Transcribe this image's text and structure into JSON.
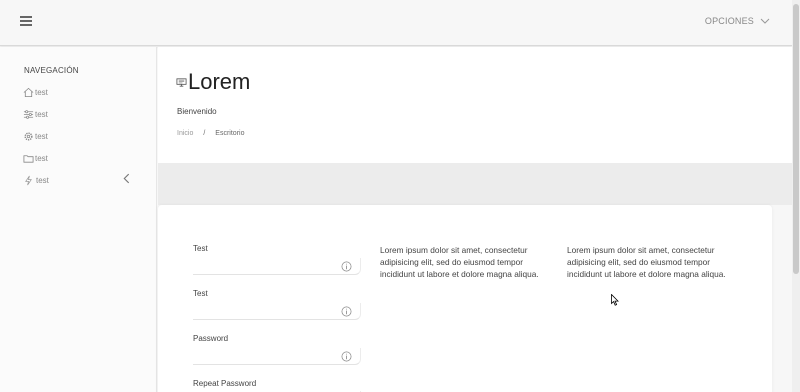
{
  "topbar": {
    "options_label": "OPCIONES"
  },
  "sidebar": {
    "title": "NAVEGACIÓN",
    "items": [
      {
        "label": "test",
        "icon": "home-icon"
      },
      {
        "label": "test",
        "icon": "sliders-icon"
      },
      {
        "label": "test",
        "icon": "gear-icon"
      },
      {
        "label": "test",
        "icon": "folder-icon"
      },
      {
        "label": "test",
        "icon": "lightning-icon"
      }
    ]
  },
  "header": {
    "icon": "computer-icon",
    "title": "Lorem",
    "welcome": "Bienvenido",
    "breadcrumb": {
      "home": "Inicio",
      "separator": "/",
      "current": "Escritorio"
    }
  },
  "form": {
    "fields": [
      {
        "label": "Test",
        "value": ""
      },
      {
        "label": "Test",
        "value": ""
      },
      {
        "label": "Password",
        "value": ""
      },
      {
        "label": "Repeat Password",
        "value": ""
      }
    ]
  },
  "content": {
    "col1": "Lorem ipsum dolor sit amet, consectetur adipisicing elit, sed do eiusmod tempor incididunt ut labore et dolore magna aliqua.",
    "col2": "Lorem ipsum dolor sit amet, consectetur adipisicing elit, sed do eiusmod tempor incididunt ut labore et dolore magna aliqua."
  }
}
